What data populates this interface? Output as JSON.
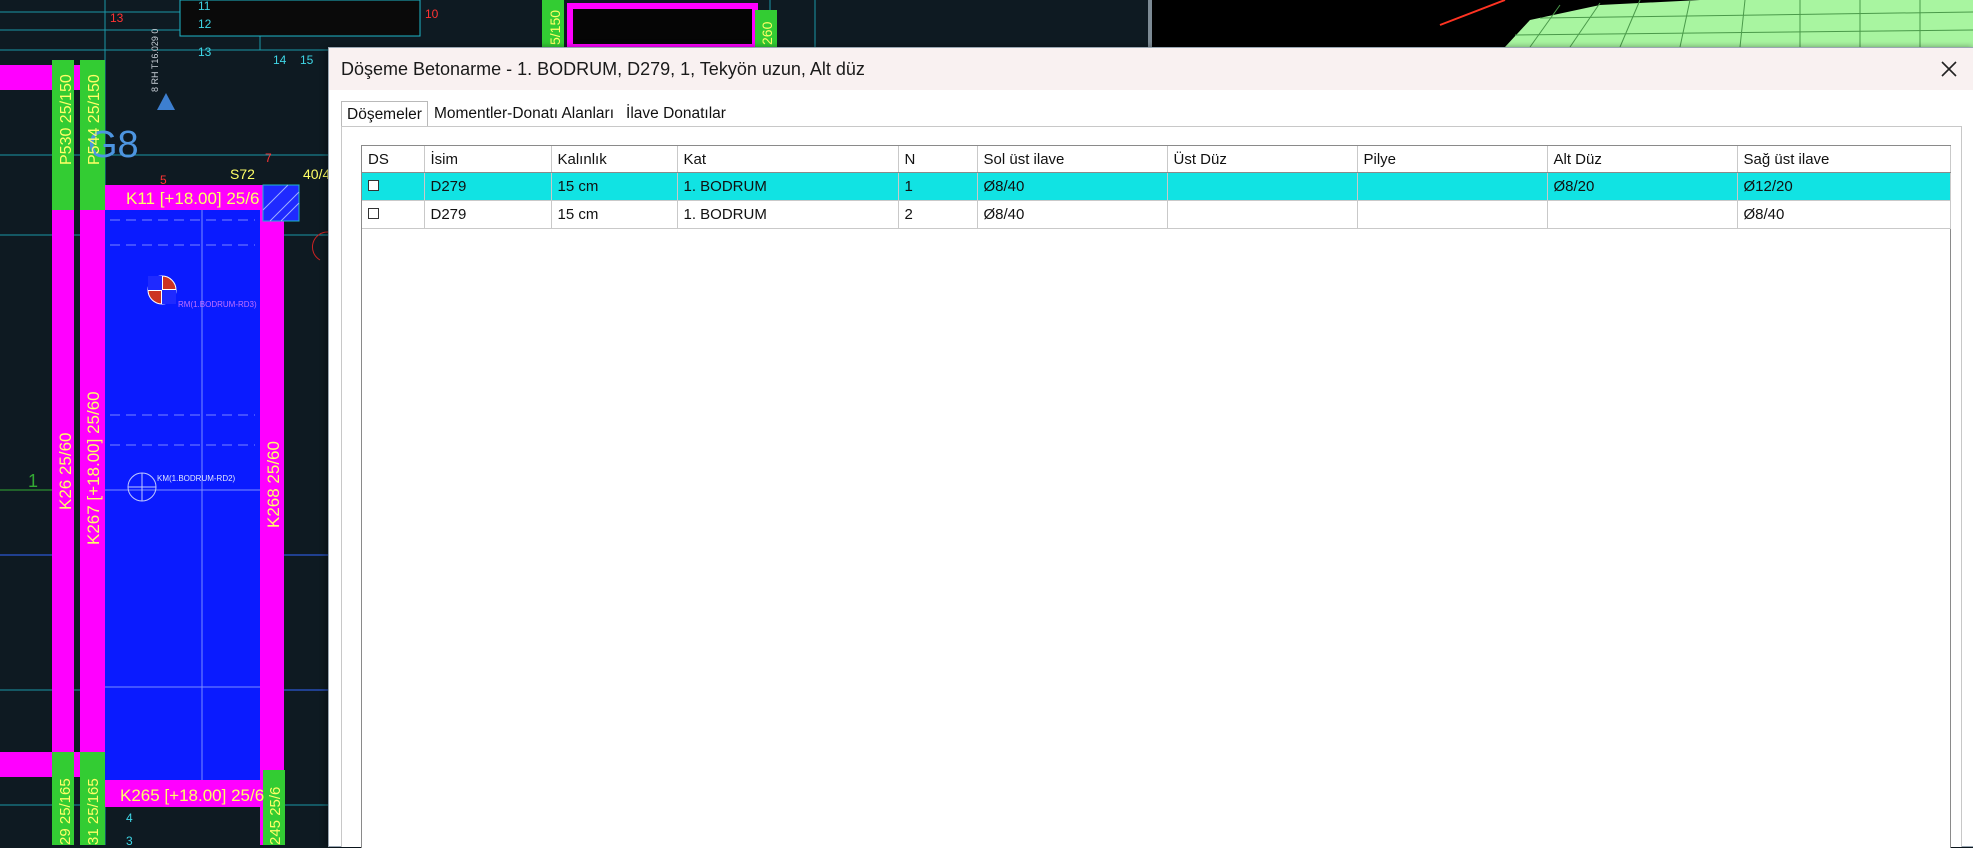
{
  "dialog": {
    "title": "Döşeme Betonarme - 1. BODRUM, D279, 1, Tekyön uzun, Alt düz",
    "tabs": [
      {
        "label": "Döşemeler",
        "active": true
      },
      {
        "label": "Momentler-Donatı Alanları",
        "active": false
      },
      {
        "label": "İlave Donatılar",
        "active": false
      }
    ],
    "columns": [
      "DS",
      "İsim",
      "Kalınlık",
      "Kat",
      "N",
      "Sol üst ilave",
      "Üst Düz",
      "Pilye",
      "Alt Düz",
      "Sağ üst ilave"
    ],
    "rows": [
      {
        "selected": true,
        "cells": [
          "",
          "D279",
          "15 cm",
          "1. BODRUM",
          "1",
          "Ø8/40",
          "",
          "",
          "Ø8/20",
          "Ø12/20"
        ]
      },
      {
        "selected": false,
        "cells": [
          "",
          "D279",
          "15 cm",
          "1. BODRUM",
          "2",
          "Ø8/40",
          "",
          "",
          "",
          "Ø8/40"
        ]
      }
    ],
    "selection_color": "#11e3e3"
  },
  "cad": {
    "colors": {
      "background": "#0e1a22",
      "slab": "#0a1bff",
      "beam": "#ff00ff",
      "column": "#33cc33",
      "mesh": "#99ff99"
    },
    "labels": {
      "g8": "G8",
      "k11": "K11 [+18.00] 25/6",
      "k265": "K265 [+18.00] 25/6",
      "k26": "K26  25/60",
      "k267": "K267 [+18.00]  25/60",
      "k268": "K268  25/60",
      "p530": "P530 25/150",
      "p544": "P544 25/150",
      "s72": "S72",
      "n404": "40/4",
      "rm": "RM(1.BODRUM-RD3)",
      "km": "KM(1.BODRUM-RD2)",
      "axis1": "1",
      "n13a": "13",
      "n11": "11",
      "n12": "12",
      "n13b": "13",
      "n14": "14",
      "n15": "15",
      "n10": "10",
      "n7": "7",
      "n5": "5",
      "n4": "4",
      "n3": "3",
      "c5150": "5/150",
      "c260": "260",
      "c245": "245 25/6",
      "c29": "29 25/165",
      "c31": "31 25/165",
      "vertical": "8 RH T16.029 0"
    }
  }
}
